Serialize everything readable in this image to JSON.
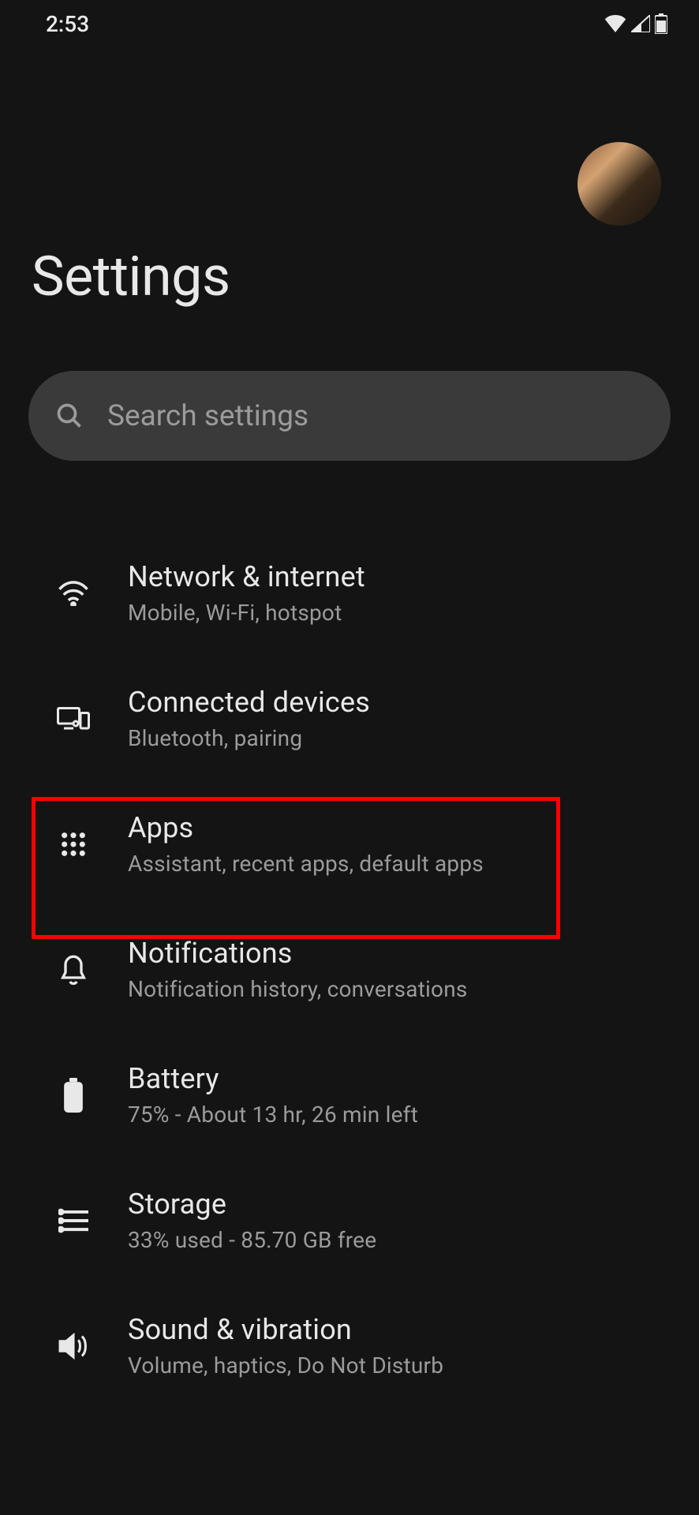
{
  "status": {
    "time": "2:53"
  },
  "header": {
    "title": "Settings"
  },
  "search": {
    "placeholder": "Search settings"
  },
  "items": [
    {
      "title": "Network & internet",
      "subtitle": "Mobile, Wi-Fi, hotspot",
      "icon": "wifi"
    },
    {
      "title": "Connected devices",
      "subtitle": "Bluetooth, pairing",
      "icon": "devices"
    },
    {
      "title": "Apps",
      "subtitle": "Assistant, recent apps, default apps",
      "icon": "apps"
    },
    {
      "title": "Notifications",
      "subtitle": "Notification history, conversations",
      "icon": "bell"
    },
    {
      "title": "Battery",
      "subtitle": "75% - About 13 hr, 26 min left",
      "icon": "battery"
    },
    {
      "title": "Storage",
      "subtitle": "33% used - 85.70 GB free",
      "icon": "storage"
    },
    {
      "title": "Sound & vibration",
      "subtitle": "Volume, haptics, Do Not Disturb",
      "icon": "sound"
    }
  ]
}
